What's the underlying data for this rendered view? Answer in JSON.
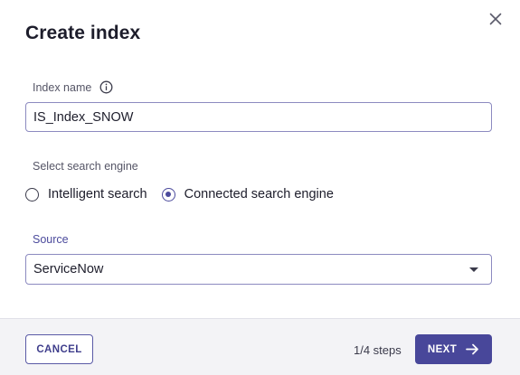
{
  "dialog": {
    "title": "Create index",
    "close_icon": "close-icon"
  },
  "index_name": {
    "label": "Index name",
    "info_icon": "info-icon",
    "value": "IS_Index_SNOW"
  },
  "search_engine": {
    "label": "Select search engine",
    "options": [
      {
        "label": "Intelligent search",
        "selected": false
      },
      {
        "label": "Connected search engine",
        "selected": true
      }
    ]
  },
  "source": {
    "label": "Source",
    "value": "ServiceNow",
    "icon": "chevron-down-icon"
  },
  "footer": {
    "cancel_label": "CANCEL",
    "steps": "1/4 steps",
    "next_label": "NEXT",
    "next_icon": "arrow-right-icon"
  },
  "colors": {
    "accent": "#48479a",
    "border": "#8c8ac0",
    "footer_bg": "#f3f3f6"
  }
}
